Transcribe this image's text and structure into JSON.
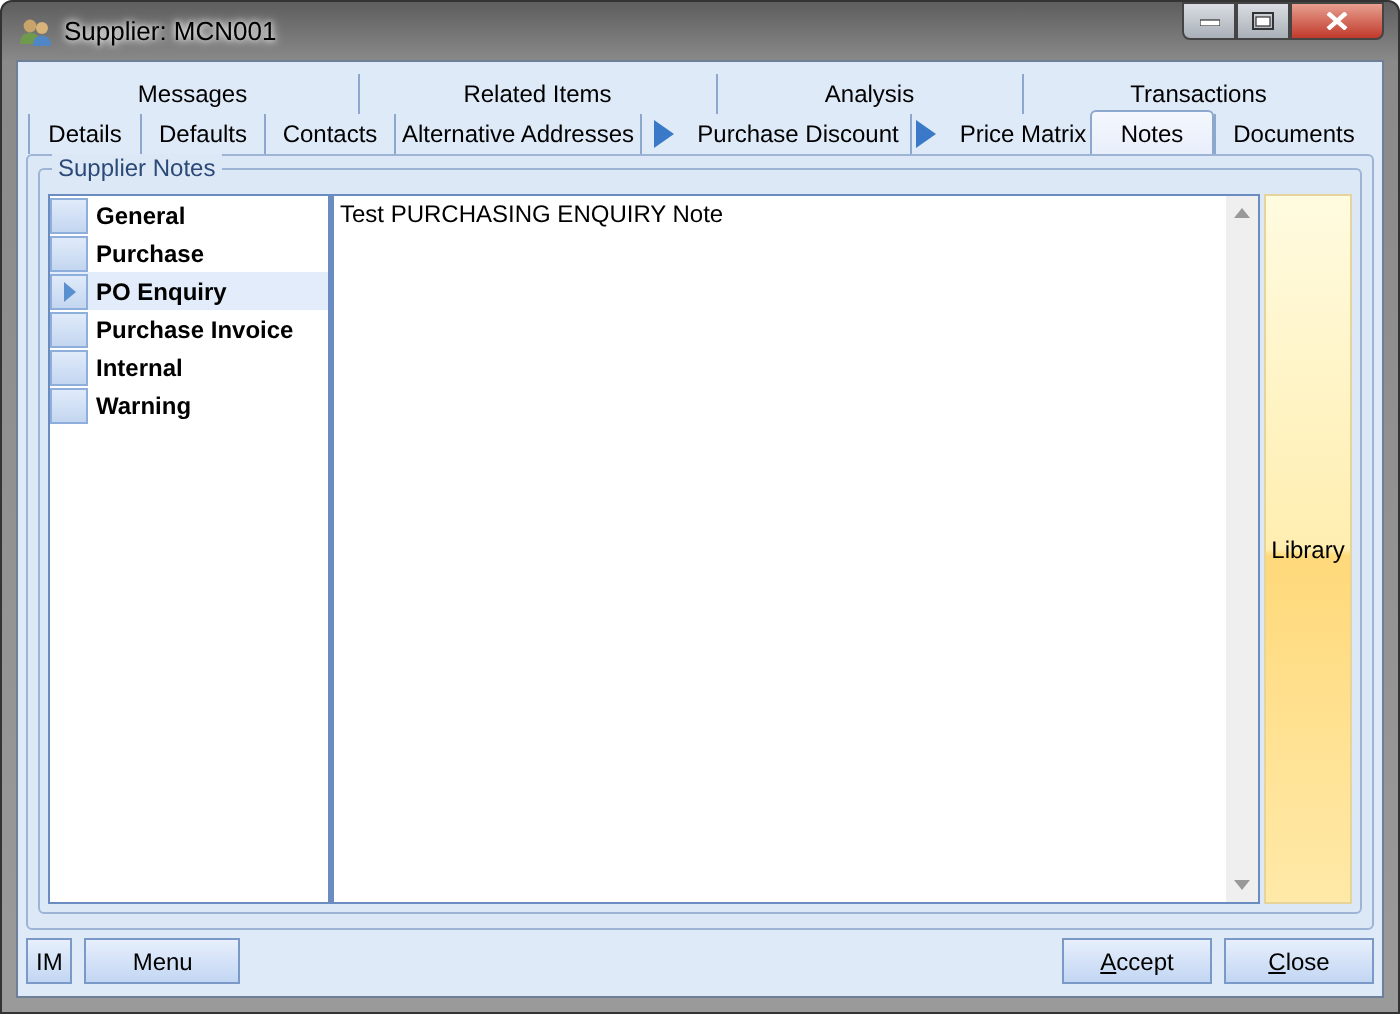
{
  "window": {
    "title": "Supplier: MCN001"
  },
  "tab_rows": [
    [
      {
        "label": "Messages",
        "selected": false,
        "arrow": false
      },
      {
        "label": "Related Items",
        "selected": false,
        "arrow": false
      },
      {
        "label": "Analysis",
        "selected": false,
        "arrow": false
      },
      {
        "label": "Transactions",
        "selected": false,
        "arrow": false
      }
    ],
    [
      {
        "label": "Details",
        "selected": false,
        "arrow": false
      },
      {
        "label": "Defaults",
        "selected": false,
        "arrow": false
      },
      {
        "label": "Contacts",
        "selected": false,
        "arrow": false
      },
      {
        "label": "Alternative Addresses",
        "selected": false,
        "arrow": false
      },
      {
        "label": "Purchase Discount",
        "selected": false,
        "arrow": true
      },
      {
        "label": "Price Matrix",
        "selected": false,
        "arrow": true
      },
      {
        "label": "Notes",
        "selected": true,
        "arrow": false
      },
      {
        "label": "Documents",
        "selected": false,
        "arrow": false
      }
    ]
  ],
  "group": {
    "title": "Supplier Notes"
  },
  "note_types": [
    {
      "label": "General",
      "selected": false
    },
    {
      "label": "Purchase",
      "selected": false
    },
    {
      "label": "PO Enquiry",
      "selected": true
    },
    {
      "label": "Purchase Invoice",
      "selected": false
    },
    {
      "label": "Internal",
      "selected": false
    },
    {
      "label": "Warning",
      "selected": false
    }
  ],
  "note_text": "Test PURCHASING ENQUIRY Note",
  "library_button": "Library",
  "buttons_left": [
    {
      "label": "IM",
      "underline_first": false
    },
    {
      "label": "Menu",
      "underline_first": false
    }
  ],
  "buttons_right": [
    {
      "label": "Accept",
      "underline_first": true
    },
    {
      "label": "Close",
      "underline_first": true
    }
  ]
}
